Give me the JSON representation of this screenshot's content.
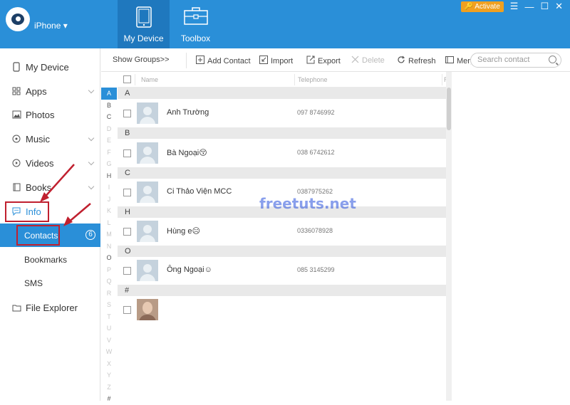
{
  "header": {
    "device_name": "iPhone ▾",
    "tabs": [
      {
        "label": "My Device",
        "active": true
      },
      {
        "label": "Toolbox",
        "active": false
      }
    ],
    "activate_label": "Activate"
  },
  "sidebar": {
    "items": [
      {
        "label": "My Device",
        "icon": "phone-icon"
      },
      {
        "label": "Apps",
        "icon": "apps-grid-icon"
      },
      {
        "label": "Photos",
        "icon": "photo-icon"
      },
      {
        "label": "Music",
        "icon": "music-icon"
      },
      {
        "label": "Videos",
        "icon": "video-icon"
      },
      {
        "label": "Books",
        "icon": "book-icon"
      },
      {
        "label": "Info",
        "icon": "message-icon"
      }
    ],
    "info_children": [
      {
        "label": "Contacts",
        "count": "6",
        "active": true
      },
      {
        "label": "Bookmarks"
      },
      {
        "label": "SMS"
      }
    ],
    "file_explorer": {
      "label": "File Explorer",
      "icon": "folder-icon"
    }
  },
  "toolbar": {
    "show_groups": "Show Groups>>",
    "add_contact": "Add Contact",
    "import": "Import",
    "export": "Export",
    "delete": "Delete",
    "refresh": "Refresh",
    "merge": "Merg",
    "search_placeholder": "Search contact"
  },
  "list": {
    "columns": {
      "name": "Name",
      "telephone": "Telephone",
      "extra": "R"
    },
    "alphabet": [
      "A",
      "B",
      "C",
      "D",
      "E",
      "F",
      "G",
      "H",
      "I",
      "J",
      "K",
      "L",
      "M",
      "N",
      "O",
      "P",
      "Q",
      "R",
      "S",
      "T",
      "U",
      "V",
      "W",
      "X",
      "Y",
      "Z",
      "#"
    ],
    "active_letters": [
      "A",
      "B",
      "C",
      "H",
      "O",
      "#"
    ],
    "selected_letter": "A",
    "groups": [
      {
        "letter": "A",
        "contacts": [
          {
            "name": "Anh Trường",
            "phone": "097 8746992"
          }
        ]
      },
      {
        "letter": "B",
        "contacts": [
          {
            "name": "Bà Ngoại😚",
            "phone": "038 6742612"
          }
        ]
      },
      {
        "letter": "C",
        "contacts": [
          {
            "name": "Ci Thảo Viện MCC",
            "phone": "0387975262"
          }
        ]
      },
      {
        "letter": "H",
        "contacts": [
          {
            "name": "Hùng e☹",
            "phone": "0336078928"
          }
        ]
      },
      {
        "letter": "O",
        "contacts": [
          {
            "name": "Ông Ngoại☺",
            "phone": "085 3145299"
          }
        ]
      },
      {
        "letter": "#",
        "contacts": [
          {
            "name": "",
            "phone": "",
            "photo": true
          }
        ]
      }
    ]
  },
  "watermark": "freetuts.net",
  "colors": {
    "accent": "#2a8fd8",
    "annotation": "#c0202f",
    "activate": "#f0a020"
  }
}
